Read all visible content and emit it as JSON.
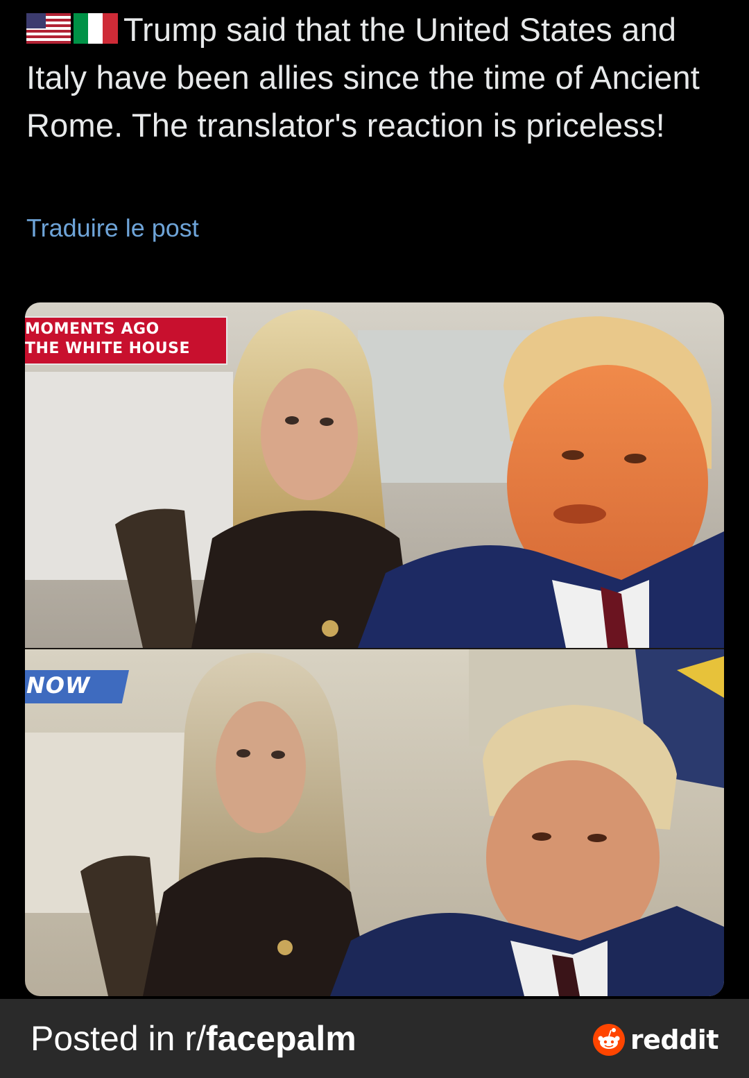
{
  "post": {
    "flags": [
      "us-flag",
      "italy-flag"
    ],
    "text": "Trump said that the United States and Italy have been allies since the time of Ancient Rome. The translator's reaction is priceless!",
    "translate_link": "Traduire le post"
  },
  "media": {
    "top_banner_line_1": "MOMENTS AGO",
    "top_banner_line_2": "THE WHITE HOUSE",
    "bottom_logo_text": "NOW"
  },
  "footer": {
    "prefix": "Posted in r/",
    "subreddit": "facepalm",
    "brand": "reddit"
  },
  "colors": {
    "background": "#000000",
    "text": "#e7e9ea",
    "link": "#6ea4d8",
    "footer_bg": "#2a2a2a",
    "reddit_orange": "#ff4500",
    "banner_red": "#c8102e"
  }
}
